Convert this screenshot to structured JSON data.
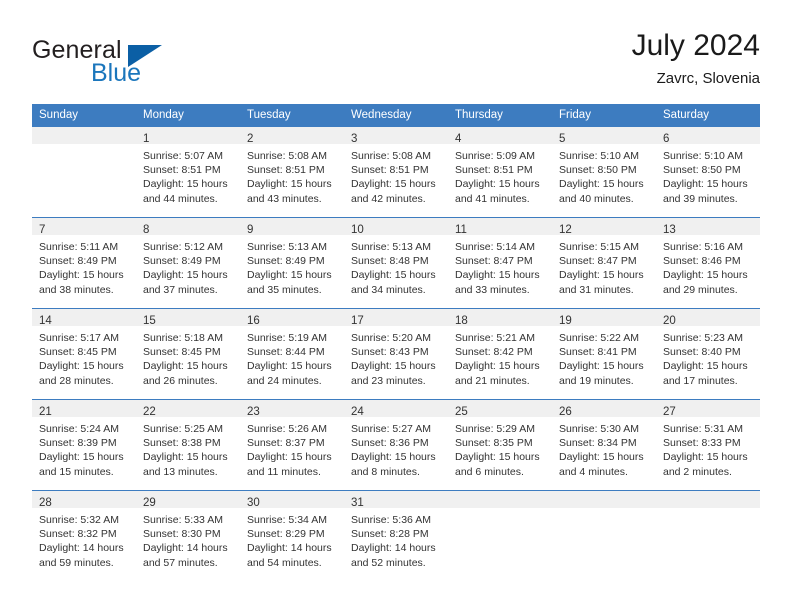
{
  "brand": {
    "name_part1": "General",
    "name_part2": "Blue",
    "logo_icon": "triangle-flag-icon"
  },
  "header": {
    "title": "July 2024",
    "location": "Zavrc, Slovenia"
  },
  "colors": {
    "header_blue": "#3d7cc0",
    "brand_blue": "#1b76bc",
    "logo_blue": "#0b5fa5",
    "daynum_band": "#f0f0f0"
  },
  "weekday_headers": [
    "Sunday",
    "Monday",
    "Tuesday",
    "Wednesday",
    "Thursday",
    "Friday",
    "Saturday"
  ],
  "weeks": [
    [
      {
        "day": "",
        "lines": []
      },
      {
        "day": "1",
        "lines": [
          "Sunrise: 5:07 AM",
          "Sunset: 8:51 PM",
          "Daylight: 15 hours",
          "and 44 minutes."
        ]
      },
      {
        "day": "2",
        "lines": [
          "Sunrise: 5:08 AM",
          "Sunset: 8:51 PM",
          "Daylight: 15 hours",
          "and 43 minutes."
        ]
      },
      {
        "day": "3",
        "lines": [
          "Sunrise: 5:08 AM",
          "Sunset: 8:51 PM",
          "Daylight: 15 hours",
          "and 42 minutes."
        ]
      },
      {
        "day": "4",
        "lines": [
          "Sunrise: 5:09 AM",
          "Sunset: 8:51 PM",
          "Daylight: 15 hours",
          "and 41 minutes."
        ]
      },
      {
        "day": "5",
        "lines": [
          "Sunrise: 5:10 AM",
          "Sunset: 8:50 PM",
          "Daylight: 15 hours",
          "and 40 minutes."
        ]
      },
      {
        "day": "6",
        "lines": [
          "Sunrise: 5:10 AM",
          "Sunset: 8:50 PM",
          "Daylight: 15 hours",
          "and 39 minutes."
        ]
      }
    ],
    [
      {
        "day": "7",
        "lines": [
          "Sunrise: 5:11 AM",
          "Sunset: 8:49 PM",
          "Daylight: 15 hours",
          "and 38 minutes."
        ]
      },
      {
        "day": "8",
        "lines": [
          "Sunrise: 5:12 AM",
          "Sunset: 8:49 PM",
          "Daylight: 15 hours",
          "and 37 minutes."
        ]
      },
      {
        "day": "9",
        "lines": [
          "Sunrise: 5:13 AM",
          "Sunset: 8:49 PM",
          "Daylight: 15 hours",
          "and 35 minutes."
        ]
      },
      {
        "day": "10",
        "lines": [
          "Sunrise: 5:13 AM",
          "Sunset: 8:48 PM",
          "Daylight: 15 hours",
          "and 34 minutes."
        ]
      },
      {
        "day": "11",
        "lines": [
          "Sunrise: 5:14 AM",
          "Sunset: 8:47 PM",
          "Daylight: 15 hours",
          "and 33 minutes."
        ]
      },
      {
        "day": "12",
        "lines": [
          "Sunrise: 5:15 AM",
          "Sunset: 8:47 PM",
          "Daylight: 15 hours",
          "and 31 minutes."
        ]
      },
      {
        "day": "13",
        "lines": [
          "Sunrise: 5:16 AM",
          "Sunset: 8:46 PM",
          "Daylight: 15 hours",
          "and 29 minutes."
        ]
      }
    ],
    [
      {
        "day": "14",
        "lines": [
          "Sunrise: 5:17 AM",
          "Sunset: 8:45 PM",
          "Daylight: 15 hours",
          "and 28 minutes."
        ]
      },
      {
        "day": "15",
        "lines": [
          "Sunrise: 5:18 AM",
          "Sunset: 8:45 PM",
          "Daylight: 15 hours",
          "and 26 minutes."
        ]
      },
      {
        "day": "16",
        "lines": [
          "Sunrise: 5:19 AM",
          "Sunset: 8:44 PM",
          "Daylight: 15 hours",
          "and 24 minutes."
        ]
      },
      {
        "day": "17",
        "lines": [
          "Sunrise: 5:20 AM",
          "Sunset: 8:43 PM",
          "Daylight: 15 hours",
          "and 23 minutes."
        ]
      },
      {
        "day": "18",
        "lines": [
          "Sunrise: 5:21 AM",
          "Sunset: 8:42 PM",
          "Daylight: 15 hours",
          "and 21 minutes."
        ]
      },
      {
        "day": "19",
        "lines": [
          "Sunrise: 5:22 AM",
          "Sunset: 8:41 PM",
          "Daylight: 15 hours",
          "and 19 minutes."
        ]
      },
      {
        "day": "20",
        "lines": [
          "Sunrise: 5:23 AM",
          "Sunset: 8:40 PM",
          "Daylight: 15 hours",
          "and 17 minutes."
        ]
      }
    ],
    [
      {
        "day": "21",
        "lines": [
          "Sunrise: 5:24 AM",
          "Sunset: 8:39 PM",
          "Daylight: 15 hours",
          "and 15 minutes."
        ]
      },
      {
        "day": "22",
        "lines": [
          "Sunrise: 5:25 AM",
          "Sunset: 8:38 PM",
          "Daylight: 15 hours",
          "and 13 minutes."
        ]
      },
      {
        "day": "23",
        "lines": [
          "Sunrise: 5:26 AM",
          "Sunset: 8:37 PM",
          "Daylight: 15 hours",
          "and 11 minutes."
        ]
      },
      {
        "day": "24",
        "lines": [
          "Sunrise: 5:27 AM",
          "Sunset: 8:36 PM",
          "Daylight: 15 hours",
          "and 8 minutes."
        ]
      },
      {
        "day": "25",
        "lines": [
          "Sunrise: 5:29 AM",
          "Sunset: 8:35 PM",
          "Daylight: 15 hours",
          "and 6 minutes."
        ]
      },
      {
        "day": "26",
        "lines": [
          "Sunrise: 5:30 AM",
          "Sunset: 8:34 PM",
          "Daylight: 15 hours",
          "and 4 minutes."
        ]
      },
      {
        "day": "27",
        "lines": [
          "Sunrise: 5:31 AM",
          "Sunset: 8:33 PM",
          "Daylight: 15 hours",
          "and 2 minutes."
        ]
      }
    ],
    [
      {
        "day": "28",
        "lines": [
          "Sunrise: 5:32 AM",
          "Sunset: 8:32 PM",
          "Daylight: 14 hours",
          "and 59 minutes."
        ]
      },
      {
        "day": "29",
        "lines": [
          "Sunrise: 5:33 AM",
          "Sunset: 8:30 PM",
          "Daylight: 14 hours",
          "and 57 minutes."
        ]
      },
      {
        "day": "30",
        "lines": [
          "Sunrise: 5:34 AM",
          "Sunset: 8:29 PM",
          "Daylight: 14 hours",
          "and 54 minutes."
        ]
      },
      {
        "day": "31",
        "lines": [
          "Sunrise: 5:36 AM",
          "Sunset: 8:28 PM",
          "Daylight: 14 hours",
          "and 52 minutes."
        ]
      },
      {
        "day": "",
        "lines": []
      },
      {
        "day": "",
        "lines": []
      },
      {
        "day": "",
        "lines": []
      }
    ]
  ]
}
